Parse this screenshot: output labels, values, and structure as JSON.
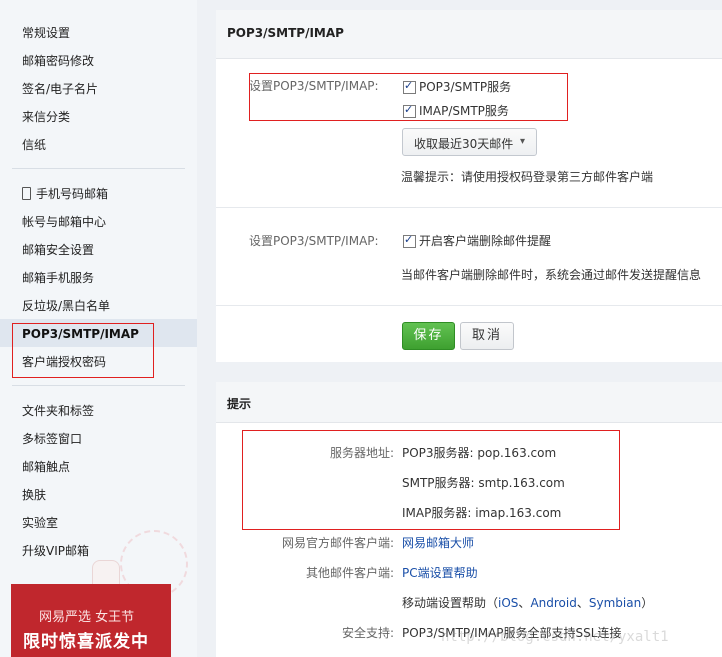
{
  "sidebar": {
    "group1": [
      "常规设置",
      "邮箱密码修改",
      "签名/电子名片",
      "来信分类",
      "信纸"
    ],
    "group2": [
      "手机号码邮箱",
      "帐号与邮箱中心",
      "邮箱安全设置",
      "邮箱手机服务",
      "反垃圾/黑白名单",
      "POP3/SMTP/IMAP",
      "客户端授权密码"
    ],
    "group3": [
      "文件夹和标签",
      "多标签窗口",
      "邮箱触点",
      "换肤",
      "实验室",
      "升级VIP邮箱"
    ],
    "active_item": "POP3/SMTP/IMAP"
  },
  "promo": {
    "line1": "网易严选 女王节",
    "line2": "限时惊喜派发中"
  },
  "settings_panel": {
    "title": "POP3/SMTP/IMAP",
    "row1_label": "设置POP3/SMTP/IMAP:",
    "pop3_option": "POP3/SMTP服务",
    "imap_option": "IMAP/SMTP服务",
    "pop3_checked": true,
    "imap_checked": true,
    "receive_range": "收取最近30天邮件",
    "tip": "温馨提示：请使用授权码登录第三方邮件客户端",
    "row2_label": "设置POP3/SMTP/IMAP:",
    "delete_alert_option": "开启客户端删除邮件提醒",
    "delete_alert_checked": true,
    "delete_alert_desc": "当邮件客户端删除邮件时，系统会通过邮件发送提醒信息",
    "save_label": "保存",
    "cancel_label": "取消"
  },
  "tips_panel": {
    "title": "提示",
    "server_label": "服务器地址:",
    "pop3_server": "POP3服务器: pop.163.com",
    "smtp_server": "SMTP服务器: smtp.163.com",
    "imap_server": "IMAP服务器: imap.163.com",
    "official_client_label": "网易官方邮件客户端:",
    "official_client_link": "网易邮箱大师",
    "other_client_label": "其他邮件客户端:",
    "pc_help_link": "PC端设置帮助",
    "mobile_help_prefix": "移动端设置帮助（",
    "mobile_help_ios": "iOS",
    "mobile_help_android": "Android",
    "mobile_help_symbian": "Symbian",
    "mobile_help_suffix": "）",
    "security_label": "安全支持:",
    "security_value": "POP3/SMTP/IMAP服务全部支持SSL连接"
  },
  "watermark": "http://blog.csdn.net/yxalt1",
  "colors": {
    "accent_red": "#e02020",
    "save_green": "#3ea030",
    "link_blue": "#1a4fa8"
  }
}
